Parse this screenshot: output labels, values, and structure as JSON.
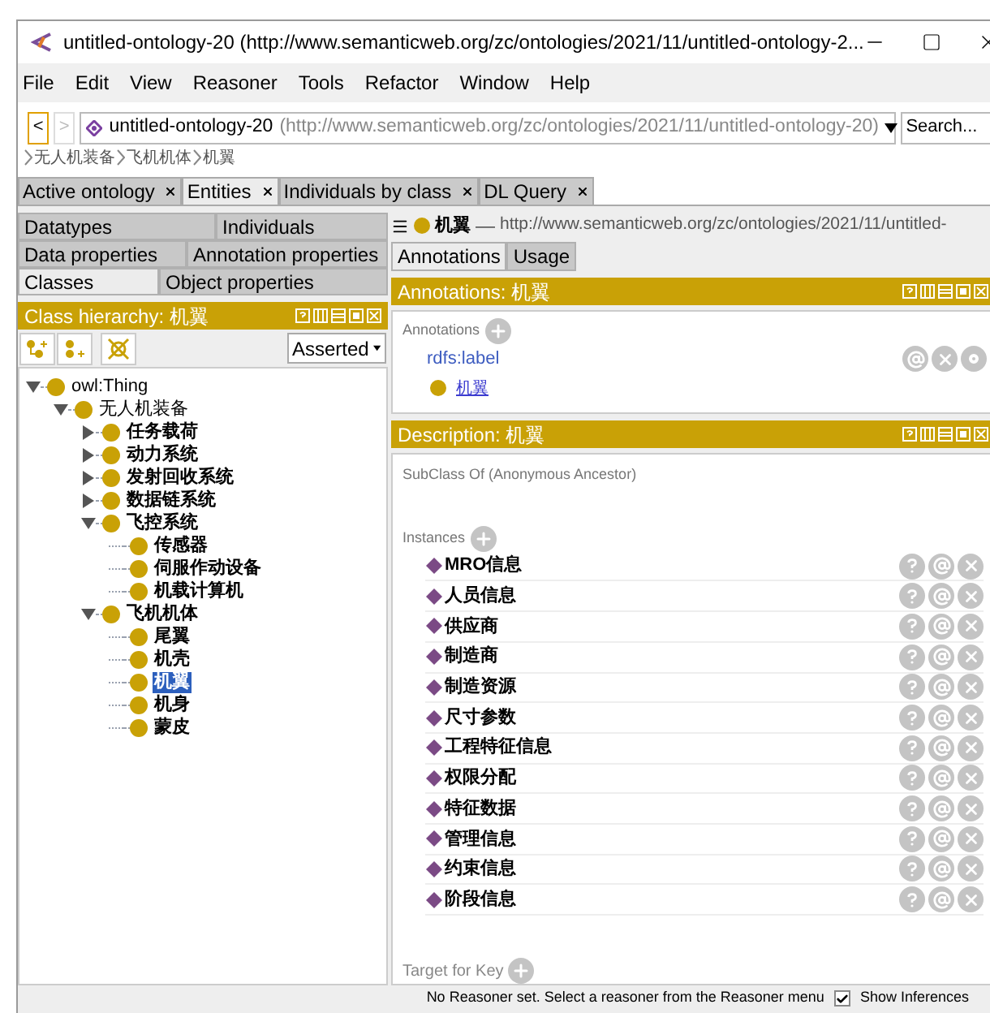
{
  "window": {
    "title": "untitled-ontology-20 (http://www.semanticweb.org/zc/ontologies/2021/11/untitled-ontology-2..."
  },
  "menu": [
    "File",
    "Edit",
    "View",
    "Reasoner",
    "Tools",
    "Refactor",
    "Window",
    "Help"
  ],
  "nav": {
    "back": "<",
    "forward": ">",
    "ontology": "untitled-ontology-20",
    "iri": "(http://www.semanticweb.org/zc/ontologies/2021/11/untitled-ontology-20)",
    "search": "Search..."
  },
  "breadcrumb": [
    "无人机装备",
    "飞机机体",
    "机翼"
  ],
  "workspace_tabs": [
    {
      "label": "Active ontology",
      "selected": false
    },
    {
      "label": "Entities",
      "selected": true
    },
    {
      "label": "Individuals by class",
      "selected": false
    },
    {
      "label": "DL Query",
      "selected": false
    }
  ],
  "entity_tabs": [
    [
      {
        "label": "Datatypes",
        "selected": false
      },
      {
        "label": "Individuals",
        "selected": false
      }
    ],
    [
      {
        "label": "Data properties",
        "selected": false
      },
      {
        "label": "Annotation properties",
        "selected": false
      }
    ],
    [
      {
        "label": "Classes",
        "selected": true
      },
      {
        "label": "Object properties",
        "selected": false
      }
    ]
  ],
  "class_hierarchy": {
    "title": "Class hierarchy: 机翼",
    "mode": "Asserted",
    "tree": [
      {
        "label": "owl:Thing",
        "kind": "branch",
        "expanded": true,
        "selected": false,
        "children": [
          {
            "label": "无人机装备",
            "kind": "branch",
            "expanded": true,
            "selected": false,
            "children": [
              {
                "label": "任务载荷",
                "kind": "branch",
                "expanded": false,
                "selected": false
              },
              {
                "label": "动力系统",
                "kind": "branch",
                "expanded": false,
                "selected": false
              },
              {
                "label": "发射回收系统",
                "kind": "branch",
                "expanded": false,
                "selected": false
              },
              {
                "label": "数据链系统",
                "kind": "branch",
                "expanded": false,
                "selected": false
              },
              {
                "label": "飞控系统",
                "kind": "branch",
                "expanded": true,
                "selected": false,
                "children": [
                  {
                    "label": "传感器",
                    "kind": "leaf",
                    "selected": false
                  },
                  {
                    "label": "伺服作动设备",
                    "kind": "leaf",
                    "selected": false
                  },
                  {
                    "label": "机载计算机",
                    "kind": "leaf",
                    "selected": false
                  }
                ]
              },
              {
                "label": "飞机机体",
                "kind": "branch",
                "expanded": true,
                "selected": false,
                "children": [
                  {
                    "label": "尾翼",
                    "kind": "leaf",
                    "selected": false
                  },
                  {
                    "label": "机壳",
                    "kind": "leaf",
                    "selected": false
                  },
                  {
                    "label": "机翼",
                    "kind": "leaf",
                    "selected": true
                  },
                  {
                    "label": "机身",
                    "kind": "leaf",
                    "selected": false
                  },
                  {
                    "label": "蒙皮",
                    "kind": "leaf",
                    "selected": false
                  }
                ]
              }
            ]
          }
        ]
      }
    ]
  },
  "entity": {
    "name": "机翼",
    "dash": "—",
    "iri": "http://www.semanticweb.org/zc/ontologies/2021/11/untitled-"
  },
  "entity_tabs_right": [
    {
      "label": "Annotations",
      "selected": true
    },
    {
      "label": "Usage",
      "selected": false
    }
  ],
  "annotations": {
    "title": "Annotations: 机翼",
    "section": "Annotations",
    "property": "rdfs:label",
    "value": "机翼"
  },
  "description": {
    "title": "Description: 机翼",
    "subclass": "SubClass Of (Anonymous Ancestor)",
    "instances_label": "Instances",
    "target": "Target for Key",
    "instances": [
      "MRO信息",
      "人员信息",
      "供应商",
      "制造商",
      "制造资源",
      "尺寸参数",
      "工程特征信息",
      "权限分配",
      "特征数据",
      "管理信息",
      "约束信息",
      "阶段信息"
    ]
  },
  "status": {
    "text": "No Reasoner set. Select a reasoner from the Reasoner menu",
    "show_inferences": {
      "label": "Show Inferences",
      "checked": true
    }
  }
}
